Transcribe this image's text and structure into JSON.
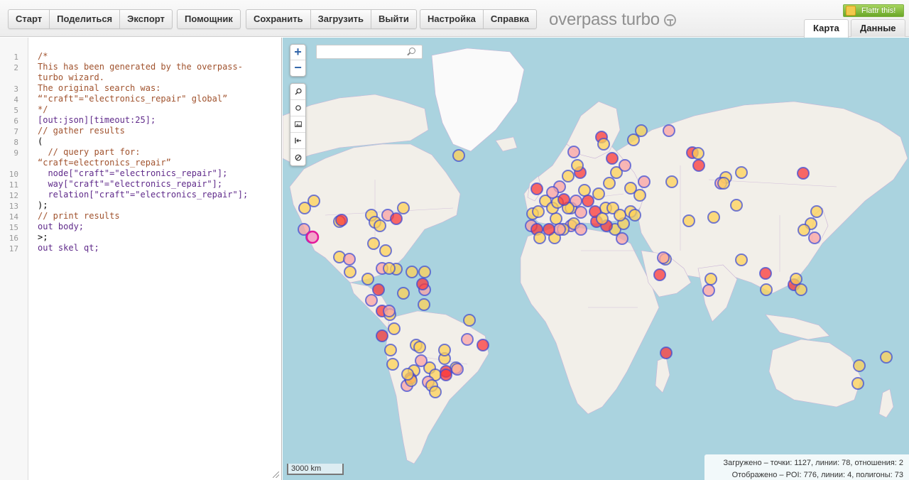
{
  "toolbar": {
    "groups": [
      {
        "buttons": [
          "Старт",
          "Поделиться",
          "Экспорт"
        ]
      },
      {
        "buttons": [
          "Помощник"
        ]
      },
      {
        "buttons": [
          "Сохранить",
          "Загрузить",
          "Выйти"
        ]
      },
      {
        "buttons": [
          "Настройка",
          "Справка"
        ]
      }
    ],
    "logo": "overpass turbo",
    "flattr_label": "Flattr this!",
    "tabs": {
      "map": "Карта",
      "data": "Данные"
    }
  },
  "editor": {
    "line_numbers": [
      "1",
      "2",
      "3",
      "4",
      "5",
      "6",
      "7",
      "8",
      "9",
      "10",
      "11",
      "12",
      "13",
      "14",
      "15",
      "16",
      "17"
    ],
    "lines": [
      "/*",
      "This has been generated by the overpass-",
      "turbo wizard.",
      "The original search was:",
      "“\"craft\"=\"electronics_repair\" global”",
      "*/",
      "[out:json][timeout:25];",
      "// gather results",
      "(",
      "  // query part for:",
      "“craft=electronics_repair”",
      "  node[\"craft\"=\"electronics_repair\"];",
      "  way[\"craft\"=\"electronics_repair\"];",
      "  relation[\"craft\"=\"electronics_repair\"];",
      ");",
      "// print results",
      "out body;",
      ">;",
      "out skel qt;"
    ]
  },
  "map": {
    "zoom_in": "+",
    "zoom_out": "−",
    "search_value": "",
    "scale_label": "3000 km",
    "stats_loaded": "Загружено – точки: 1127, линии: 78, отношения: 2",
    "stats_shown": "Отображено – POI: 776, линии: 4, полигоны: 73",
    "colors": {
      "water": "#aad3df",
      "land": "#f2efe9",
      "ice": "#fafafa",
      "poi_fill": "#fed257",
      "poi_stroke": "#3b48d4",
      "poi_hot": "#f93838"
    }
  }
}
